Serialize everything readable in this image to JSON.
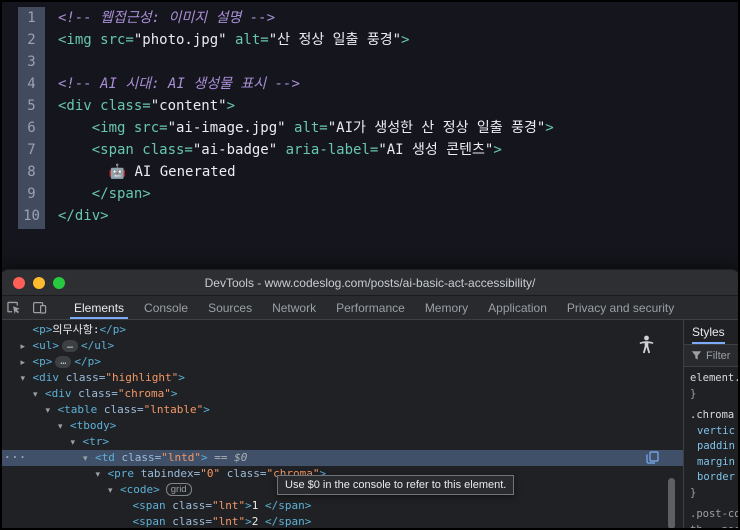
{
  "editor": {
    "lines": [
      {
        "num": "1",
        "segments": [
          {
            "t": "<!-- 웹접근성: 이미지 설명 -->",
            "c": "comment"
          }
        ]
      },
      {
        "num": "2",
        "segments": [
          {
            "t": "<img src=",
            "c": "tag"
          },
          {
            "t": "\"photo.jpg\"",
            "c": "string"
          },
          {
            "t": " alt=",
            "c": "tag"
          },
          {
            "t": "\"산 정상 일출 풍경\"",
            "c": "string"
          },
          {
            "t": ">",
            "c": "tag"
          }
        ]
      },
      {
        "num": "3",
        "segments": []
      },
      {
        "num": "4",
        "segments": [
          {
            "t": "<!-- AI 시대: AI 생성물 표시 -->",
            "c": "comment"
          }
        ]
      },
      {
        "num": "5",
        "segments": [
          {
            "t": "<div class=",
            "c": "tag"
          },
          {
            "t": "\"content\"",
            "c": "string"
          },
          {
            "t": ">",
            "c": "tag"
          }
        ]
      },
      {
        "num": "6",
        "segments": [
          {
            "t": "    ",
            "c": "plain"
          },
          {
            "t": "<img src=",
            "c": "tag"
          },
          {
            "t": "\"ai-image.jpg\"",
            "c": "string"
          },
          {
            "t": " alt=",
            "c": "tag"
          },
          {
            "t": "\"AI가 생성한 산 정상 일출 풍경\"",
            "c": "string"
          },
          {
            "t": ">",
            "c": "tag"
          }
        ]
      },
      {
        "num": "7",
        "segments": [
          {
            "t": "    ",
            "c": "plain"
          },
          {
            "t": "<span class=",
            "c": "tag"
          },
          {
            "t": "\"ai-badge\"",
            "c": "string"
          },
          {
            "t": " aria-label=",
            "c": "tag"
          },
          {
            "t": "\"AI 생성 콘텐츠\"",
            "c": "string"
          },
          {
            "t": ">",
            "c": "tag"
          }
        ]
      },
      {
        "num": "8",
        "segments": [
          {
            "t": "      ",
            "c": "plain"
          },
          {
            "t": "🤖 AI Generated",
            "c": "plain"
          }
        ]
      },
      {
        "num": "9",
        "segments": [
          {
            "t": "    ",
            "c": "plain"
          },
          {
            "t": "</span>",
            "c": "tag"
          }
        ]
      },
      {
        "num": "10",
        "segments": [
          {
            "t": "</div>",
            "c": "tag"
          }
        ]
      }
    ]
  },
  "devtools": {
    "title": "DevTools - www.codeslog.com/posts/ai-basic-act-accessibility/",
    "tabs": [
      {
        "label": "Elements",
        "active": true
      },
      {
        "label": "Console",
        "active": false
      },
      {
        "label": "Sources",
        "active": false
      },
      {
        "label": "Network",
        "active": false
      },
      {
        "label": "Performance",
        "active": false
      },
      {
        "label": "Memory",
        "active": false
      },
      {
        "label": "Application",
        "active": false
      },
      {
        "label": "Privacy and security",
        "active": false
      }
    ],
    "tooltip": "Use $0 in the console to refer to this element.",
    "dom_rows": [
      {
        "indent": 1,
        "arrow": "none",
        "segments": [
          {
            "t": "<p>",
            "c": "tag"
          },
          {
            "t": "의무사항:",
            "c": "text"
          },
          {
            "t": "</p>",
            "c": "tag"
          }
        ]
      },
      {
        "indent": 1,
        "arrow": "right",
        "segments": [
          {
            "t": "<ul>",
            "c": "tag"
          },
          {
            "t": "…",
            "c": "ellipsis"
          },
          {
            "t": "</ul>",
            "c": "tag"
          }
        ]
      },
      {
        "indent": 1,
        "arrow": "right",
        "segments": [
          {
            "t": "<p>",
            "c": "tag"
          },
          {
            "t": "…",
            "c": "ellipsis"
          },
          {
            "t": "</p>",
            "c": "tag"
          }
        ]
      },
      {
        "indent": 1,
        "arrow": "down",
        "segments": [
          {
            "t": "<div",
            "c": "tag"
          },
          {
            "t": " class=",
            "c": "attr"
          },
          {
            "t": "\"highlight\"",
            "c": "value"
          },
          {
            "t": ">",
            "c": "tag"
          }
        ]
      },
      {
        "indent": 2,
        "arrow": "down",
        "segments": [
          {
            "t": "<div",
            "c": "tag"
          },
          {
            "t": " class=",
            "c": "attr"
          },
          {
            "t": "\"chroma\"",
            "c": "value"
          },
          {
            "t": ">",
            "c": "tag"
          }
        ]
      },
      {
        "indent": 3,
        "arrow": "down",
        "segments": [
          {
            "t": "<table",
            "c": "tag"
          },
          {
            "t": " class=",
            "c": "attr"
          },
          {
            "t": "\"lntable\"",
            "c": "value"
          },
          {
            "t": ">",
            "c": "tag"
          }
        ]
      },
      {
        "indent": 4,
        "arrow": "down",
        "segments": [
          {
            "t": "<tbody>",
            "c": "tag"
          }
        ]
      },
      {
        "indent": 5,
        "arrow": "down",
        "segments": [
          {
            "t": "<tr>",
            "c": "tag"
          }
        ]
      },
      {
        "indent": 6,
        "arrow": "down",
        "selected": true,
        "dots": true,
        "copy": true,
        "segments": [
          {
            "t": "<td",
            "c": "tag"
          },
          {
            "t": " class=",
            "c": "attr"
          },
          {
            "t": "\"lntd\"",
            "c": "value"
          },
          {
            "t": ">",
            "c": "tag"
          },
          {
            "t": " == $0",
            "c": "eq"
          }
        ]
      },
      {
        "indent": 7,
        "arrow": "down",
        "segments": [
          {
            "t": "<pre",
            "c": "tag"
          },
          {
            "t": " tabindex=",
            "c": "attr"
          },
          {
            "t": "\"0\"",
            "c": "value"
          },
          {
            "t": " class=",
            "c": "attr"
          },
          {
            "t": "\"chroma\"",
            "c": "value"
          },
          {
            "t": ">",
            "c": "tag"
          }
        ]
      },
      {
        "indent": 8,
        "arrow": "down",
        "badge": "grid",
        "segments": [
          {
            "t": "<code>",
            "c": "tag"
          }
        ]
      },
      {
        "indent": 9,
        "arrow": "none",
        "segments": [
          {
            "t": "<span",
            "c": "tag"
          },
          {
            "t": " class=",
            "c": "attr"
          },
          {
            "t": "\"lnt\"",
            "c": "value"
          },
          {
            "t": ">",
            "c": "tag"
          },
          {
            "t": "1 ",
            "c": "text"
          },
          {
            "t": "</span>",
            "c": "tag"
          }
        ]
      },
      {
        "indent": 9,
        "arrow": "none",
        "segments": [
          {
            "t": "<span",
            "c": "tag"
          },
          {
            "t": " class=",
            "c": "attr"
          },
          {
            "t": "\"lnt\"",
            "c": "value"
          },
          {
            "t": ">",
            "c": "tag"
          },
          {
            "t": "2 ",
            "c": "text"
          },
          {
            "t": "</span>",
            "c": "tag"
          }
        ]
      }
    ],
    "styles_panel": {
      "tab": "Styles",
      "filter": "Filter",
      "lines": [
        {
          "t": "element.",
          "c": "selector"
        },
        {
          "t": "}",
          "c": "brace"
        },
        {
          "t": ".chroma",
          "c": "selector",
          "gap": true
        },
        {
          "t": "vertic",
          "c": "prop"
        },
        {
          "t": "paddin",
          "c": "prop"
        },
        {
          "t": "margin",
          "c": "prop"
        },
        {
          "t": "border",
          "c": "prop"
        },
        {
          "t": "}",
          "c": "brace"
        },
        {
          "t": ".post-co",
          "c": "selector-dim",
          "gap": true
        },
        {
          "t": "th, .pos",
          "c": "selector-dim"
        }
      ]
    },
    "colors": {
      "accent_blue": "#7cacf8",
      "tag": "#5db0d7",
      "attr_value_orange": "#f29766",
      "selected_row": "#405068"
    },
    "icons": [
      "close-window-button",
      "minimize-window-button",
      "zoom-window-button",
      "inspect-element-icon",
      "device-toolbar-icon",
      "accessibility-person-icon",
      "copy-element-icon",
      "filter-funnel-icon",
      "more-dots-icon"
    ]
  }
}
